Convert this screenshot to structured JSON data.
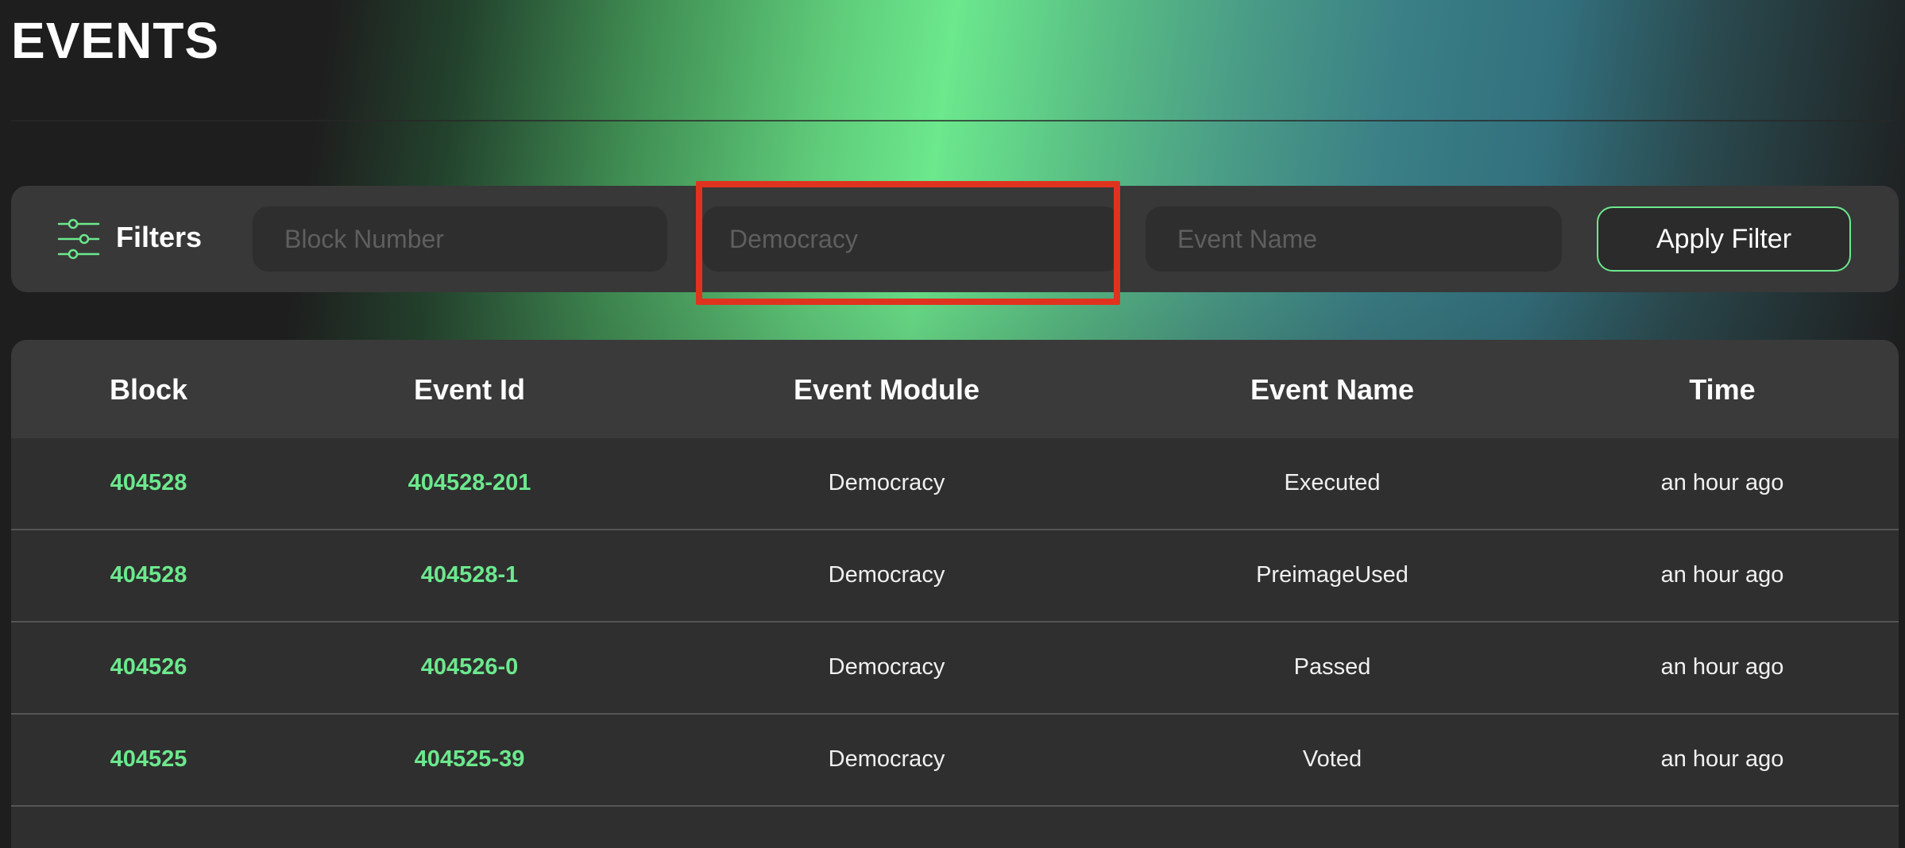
{
  "page": {
    "title": "EVENTS"
  },
  "colors": {
    "accent": "#6ce88d",
    "highlight": "#e0331f",
    "surface": "#383838",
    "background": "#1e1e1e"
  },
  "filters": {
    "icon": "sliders-icon",
    "label": "Filters",
    "block_number": {
      "placeholder": "Block Number",
      "value": ""
    },
    "module": {
      "placeholder": "Democracy",
      "value": ""
    },
    "event_name": {
      "placeholder": "Event Name",
      "value": ""
    },
    "apply_label": "Apply Filter"
  },
  "table": {
    "columns": [
      "Block",
      "Event Id",
      "Event Module",
      "Event Name",
      "Time"
    ],
    "rows": [
      {
        "block": "404528",
        "event_id": "404528-201",
        "module": "Democracy",
        "name": "Executed",
        "time": "an hour ago"
      },
      {
        "block": "404528",
        "event_id": "404528-1",
        "module": "Democracy",
        "name": "PreimageUsed",
        "time": "an hour ago"
      },
      {
        "block": "404526",
        "event_id": "404526-0",
        "module": "Democracy",
        "name": "Passed",
        "time": "an hour ago"
      },
      {
        "block": "404525",
        "event_id": "404525-39",
        "module": "Democracy",
        "name": "Voted",
        "time": "an hour ago"
      }
    ]
  }
}
